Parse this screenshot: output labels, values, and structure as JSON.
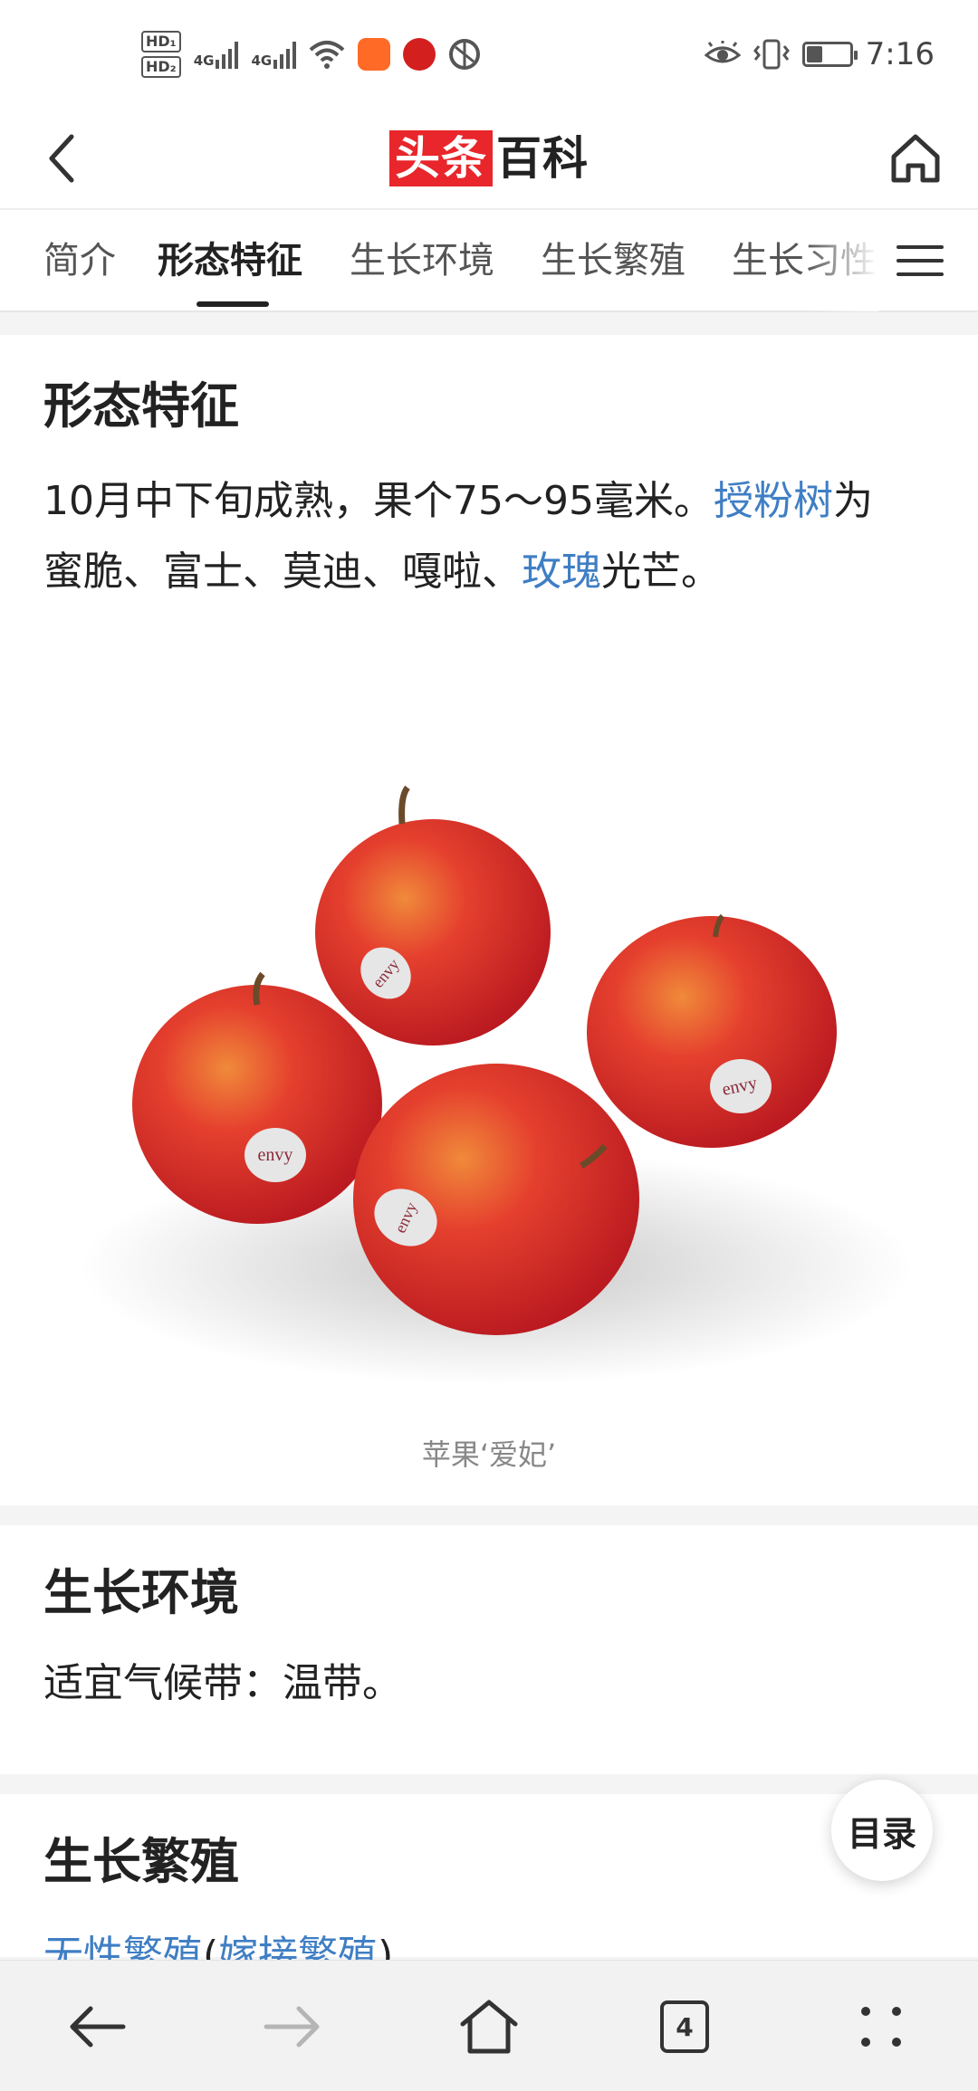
{
  "status_bar": {
    "hd1": "HD₁",
    "hd2": "HD₂",
    "net1": "4G",
    "net2": "4G",
    "time": "7:16",
    "battery_level": 0.35
  },
  "header": {
    "logo_red": "头条",
    "logo_dark": "百科"
  },
  "tabs": [
    {
      "label": "简介"
    },
    {
      "label": "形态特征"
    },
    {
      "label": "生长环境"
    },
    {
      "label": "生长繁殖"
    },
    {
      "label": "生长习性"
    }
  ],
  "active_tab_index": 1,
  "sections": {
    "morphology": {
      "title": "形态特征",
      "para_line1_a": "10月中下旬成熟，果个75～95毫米。",
      "para_line1_link": "授粉树",
      "para_line1_b": "为",
      "para_line2_a": "蜜脆、富士、莫迪、嘎啦、",
      "para_line2_link": "玫瑰",
      "para_line2_b": "光芒。",
      "image_caption": "苹果‘爱妃’",
      "sticker_text": "envy"
    },
    "environment": {
      "title": "生长环境",
      "text": "适宜气候带：温带。"
    },
    "propagation": {
      "title": "生长繁殖",
      "text_link1": "无性繁殖",
      "text_paren_open": "(",
      "text_link2": "嫁接繁殖",
      "text_paren_close": ")"
    }
  },
  "toc_button": "目录",
  "bottom_nav": {
    "tab_count": "4"
  },
  "colors": {
    "brand_red": "#e8262b",
    "link_blue": "#3f7ec4",
    "apple_red": "#d9252b"
  }
}
